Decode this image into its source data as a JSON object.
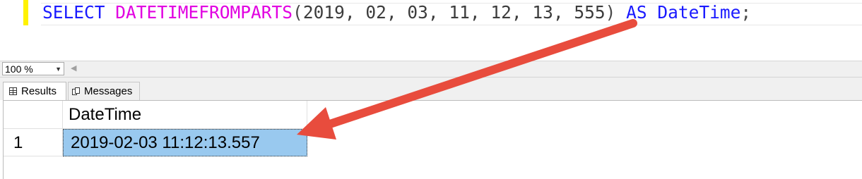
{
  "editor": {
    "tokens": {
      "select": "SELECT",
      "function": "DATETIMEFROMPARTS",
      "open_paren": "(",
      "args": "2019, 02, 03, 11, 12, 13, 555",
      "close_paren": ")",
      "as": "AS",
      "alias": "DateTime",
      "semicolon": ";"
    }
  },
  "zoom": {
    "value": "100 %"
  },
  "tabs": [
    {
      "label": "Results",
      "icon": "grid-icon",
      "active": true
    },
    {
      "label": "Messages",
      "icon": "messages-icon",
      "active": false
    }
  ],
  "results": {
    "columns": [
      "DateTime"
    ],
    "rows": [
      {
        "row_number": "1",
        "values": [
          "2019-02-03 11:12:13.557"
        ]
      }
    ]
  },
  "colors": {
    "keyword": "#1a1aff",
    "function": "#e100e1",
    "selected_cell": "#99c9ef",
    "arrow": "#e84c3d",
    "margin_highlight": "#fff200"
  }
}
